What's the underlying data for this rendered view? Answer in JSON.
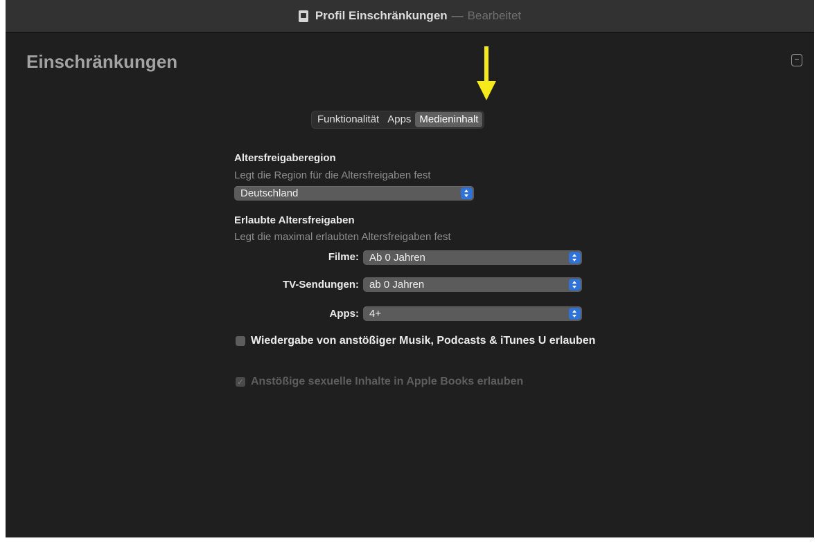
{
  "window": {
    "title": "Profil Einschränkungen",
    "title_separator": "—",
    "status": "Bearbeitet"
  },
  "section": {
    "title": "Einschränkungen"
  },
  "annotation": {
    "arrow_color": "#f6ea1a"
  },
  "tabs": [
    {
      "label": "Funktionalität",
      "active": false
    },
    {
      "label": "Apps",
      "active": false
    },
    {
      "label": "Medieninhalt",
      "active": true
    }
  ],
  "region": {
    "label": "Altersfreigaberegion",
    "description": "Legt die Region für die Altersfreigaben fest",
    "value": "Deutschland"
  },
  "ratings": {
    "label": "Erlaubte Altersfreigaben",
    "description": "Legt die maximal erlaubten Altersfreigaben fest",
    "movies_label": "Filme:",
    "movies_value": "Ab 0 Jahren",
    "tv_label": "TV-Sendungen:",
    "tv_value": "ab 0 Jahren",
    "apps_label": "Apps:",
    "apps_value": "4+"
  },
  "checkboxes": {
    "explicit_music_label": "Wiedergabe von anstößiger Musik, Podcasts & iTunes U erlauben",
    "explicit_music_checked": false,
    "books_label": "Anstößige sexuelle Inhalte in Apple Books erlauben",
    "books_checked": true
  },
  "colors": {
    "accent": "#2f73d9",
    "background": "#1f1f1f",
    "titlebar": "#323232"
  }
}
